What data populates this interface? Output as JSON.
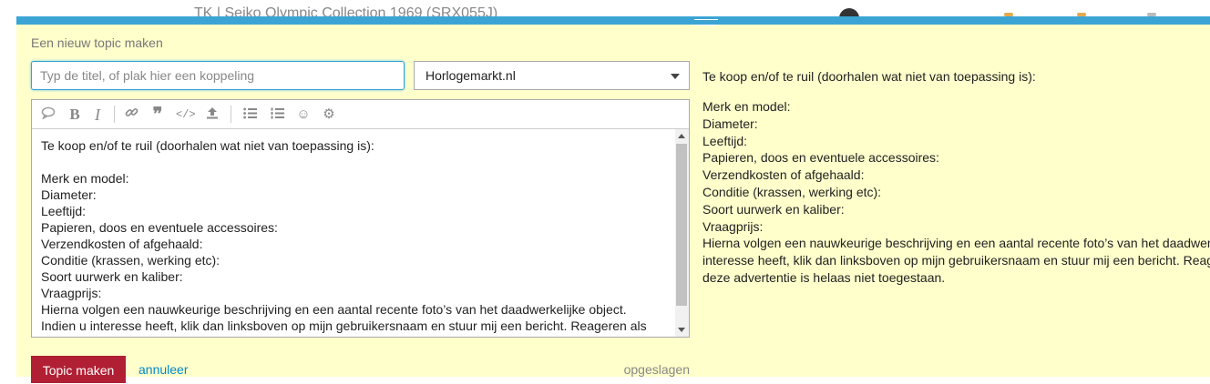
{
  "background": {
    "title": "TK | Seiko Olympic Collection 1969 (SRX055J)"
  },
  "colors": {
    "accent": "#3ca4d5",
    "composer_bg": "#ffffcc",
    "primary_button": "#b01f34",
    "link": "#0088cc"
  },
  "composer": {
    "reply_label": "Een nieuw topic maken",
    "title_placeholder": "Typ de titel, of plak hier een koppeling",
    "title_value": "",
    "category": "Horlogemarkt.nl",
    "toolbar": [
      {
        "name": "quote-icon"
      },
      {
        "name": "bold-icon"
      },
      {
        "name": "italic-icon"
      },
      {
        "name": "link-icon"
      },
      {
        "name": "blockquote-icon"
      },
      {
        "name": "code-icon"
      },
      {
        "name": "upload-icon"
      },
      {
        "name": "bullet-list-icon"
      },
      {
        "name": "numbered-list-icon"
      },
      {
        "name": "emoji-icon"
      },
      {
        "name": "gear-icon"
      }
    ],
    "editor_text": "Te koop en/of te ruil (doorhalen wat niet van toepassing is):\n\nMerk en model:\nDiameter:\nLeeftijd:\nPapieren, doos en eventuele accessoires:\nVerzendkosten of afgehaald:\nConditie (krassen, werking etc):\nSoort uurwerk en kaliber:\nVraagprijs:\nHierna volgen een nauwkeurige beschrijving en een aantal recente foto’s van het daadwerkelijke object.\nIndien u interesse heeft, klik dan linksboven op mijn gebruikersnaam en stuur mij een bericht. Reageren als",
    "submit_label": "Topic maken",
    "cancel_label": "annuleer",
    "status": "opgeslagen"
  },
  "preview": {
    "intro": "Te koop en/of te ruil (doorhalen wat niet van toepassing is):",
    "lines": [
      "Merk en model:",
      "Diameter:",
      "Leeftijd:",
      "Papieren, doos en eventuele accessoires:",
      "Verzendkosten of afgehaald:",
      "Conditie (krassen, werking etc):",
      "Soort uurwerk en kaliber:",
      "Vraagprijs:",
      "Hierna volgen een nauwkeurige beschrijving en een aantal recente foto’s van het daadwerkelijke object. Indien u",
      "interesse heeft, klik dan linksboven op mijn gebruikersnaam en stuur mij een bericht. Reageren als topic onder",
      "deze advertentie is helaas niet toegestaan."
    ]
  }
}
